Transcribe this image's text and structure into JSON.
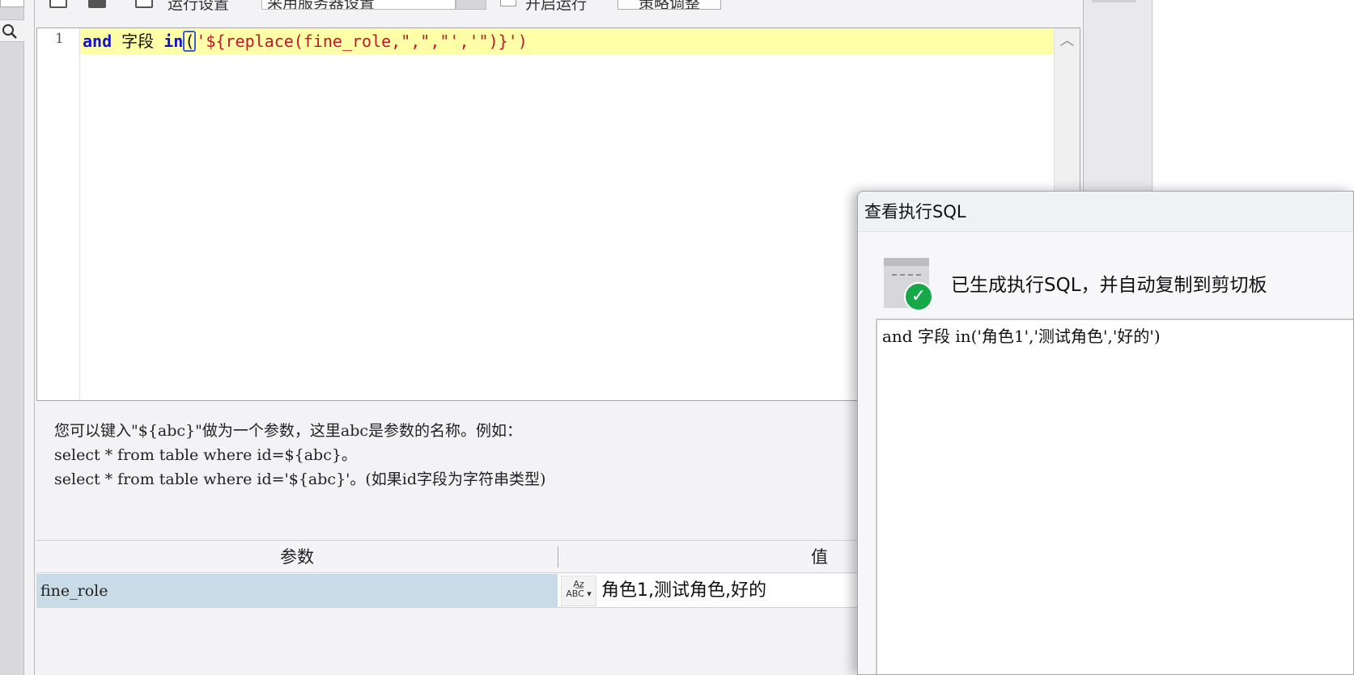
{
  "toolbar": {
    "run_settings_label": "运行设置",
    "server_settings_value": "采用服务器设置",
    "enable_run_label": "开启运行",
    "strategy_button_label": "策略调整"
  },
  "editor": {
    "line_number": "1",
    "code": {
      "kw_and": "and",
      "field": " 字段 ",
      "kw_in": "in",
      "open_paren": "(",
      "string_literal": "'${replace(fine_role,\",\",\"','\")}'",
      "close_paren": ")"
    }
  },
  "hint": {
    "line1": "您可以键入\"${abc}\"做为一个参数，这里abc是参数的名称。例如：",
    "line2": "select * from table where id=${abc}。",
    "line3": "select * from table where id='${abc}'。(如果id字段为字符串类型)"
  },
  "params": {
    "header_param": "参数",
    "header_value": "值",
    "rows": [
      {
        "name": "fine_role",
        "type_icon_label": "ABC",
        "value": "角色1,测试角色,好的"
      }
    ]
  },
  "dialog": {
    "title": "查看执行SQL",
    "message": "已生成执行SQL，并自动复制到剪切板",
    "sql": "and 字段 in('角色1','测试角色','好的')"
  },
  "colors": {
    "highlight_line": "#ffffa8",
    "keyword": "#1010cc",
    "string": "#c0182d",
    "selected_row": "#c9dbe6",
    "success_green": "#17a84a"
  }
}
